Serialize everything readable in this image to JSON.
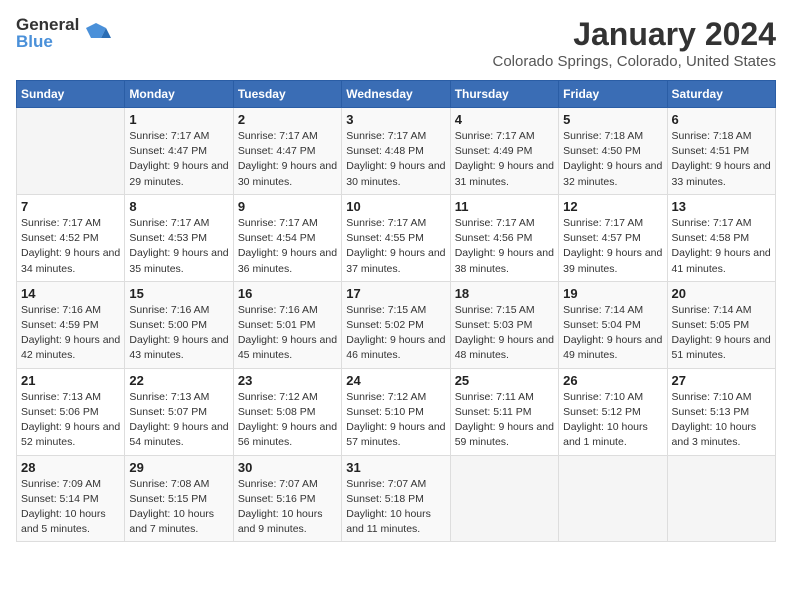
{
  "logo": {
    "general": "General",
    "blue": "Blue"
  },
  "title": "January 2024",
  "location": "Colorado Springs, Colorado, United States",
  "days_of_week": [
    "Sunday",
    "Monday",
    "Tuesday",
    "Wednesday",
    "Thursday",
    "Friday",
    "Saturday"
  ],
  "weeks": [
    [
      {
        "day": "",
        "sunrise": "",
        "sunset": "",
        "daylight": "",
        "empty": true
      },
      {
        "day": "1",
        "sunrise": "Sunrise: 7:17 AM",
        "sunset": "Sunset: 4:47 PM",
        "daylight": "Daylight: 9 hours and 29 minutes."
      },
      {
        "day": "2",
        "sunrise": "Sunrise: 7:17 AM",
        "sunset": "Sunset: 4:47 PM",
        "daylight": "Daylight: 9 hours and 30 minutes."
      },
      {
        "day": "3",
        "sunrise": "Sunrise: 7:17 AM",
        "sunset": "Sunset: 4:48 PM",
        "daylight": "Daylight: 9 hours and 30 minutes."
      },
      {
        "day": "4",
        "sunrise": "Sunrise: 7:17 AM",
        "sunset": "Sunset: 4:49 PM",
        "daylight": "Daylight: 9 hours and 31 minutes."
      },
      {
        "day": "5",
        "sunrise": "Sunrise: 7:18 AM",
        "sunset": "Sunset: 4:50 PM",
        "daylight": "Daylight: 9 hours and 32 minutes."
      },
      {
        "day": "6",
        "sunrise": "Sunrise: 7:18 AM",
        "sunset": "Sunset: 4:51 PM",
        "daylight": "Daylight: 9 hours and 33 minutes."
      }
    ],
    [
      {
        "day": "7",
        "sunrise": "Sunrise: 7:17 AM",
        "sunset": "Sunset: 4:52 PM",
        "daylight": "Daylight: 9 hours and 34 minutes."
      },
      {
        "day": "8",
        "sunrise": "Sunrise: 7:17 AM",
        "sunset": "Sunset: 4:53 PM",
        "daylight": "Daylight: 9 hours and 35 minutes."
      },
      {
        "day": "9",
        "sunrise": "Sunrise: 7:17 AM",
        "sunset": "Sunset: 4:54 PM",
        "daylight": "Daylight: 9 hours and 36 minutes."
      },
      {
        "day": "10",
        "sunrise": "Sunrise: 7:17 AM",
        "sunset": "Sunset: 4:55 PM",
        "daylight": "Daylight: 9 hours and 37 minutes."
      },
      {
        "day": "11",
        "sunrise": "Sunrise: 7:17 AM",
        "sunset": "Sunset: 4:56 PM",
        "daylight": "Daylight: 9 hours and 38 minutes."
      },
      {
        "day": "12",
        "sunrise": "Sunrise: 7:17 AM",
        "sunset": "Sunset: 4:57 PM",
        "daylight": "Daylight: 9 hours and 39 minutes."
      },
      {
        "day": "13",
        "sunrise": "Sunrise: 7:17 AM",
        "sunset": "Sunset: 4:58 PM",
        "daylight": "Daylight: 9 hours and 41 minutes."
      }
    ],
    [
      {
        "day": "14",
        "sunrise": "Sunrise: 7:16 AM",
        "sunset": "Sunset: 4:59 PM",
        "daylight": "Daylight: 9 hours and 42 minutes."
      },
      {
        "day": "15",
        "sunrise": "Sunrise: 7:16 AM",
        "sunset": "Sunset: 5:00 PM",
        "daylight": "Daylight: 9 hours and 43 minutes."
      },
      {
        "day": "16",
        "sunrise": "Sunrise: 7:16 AM",
        "sunset": "Sunset: 5:01 PM",
        "daylight": "Daylight: 9 hours and 45 minutes."
      },
      {
        "day": "17",
        "sunrise": "Sunrise: 7:15 AM",
        "sunset": "Sunset: 5:02 PM",
        "daylight": "Daylight: 9 hours and 46 minutes."
      },
      {
        "day": "18",
        "sunrise": "Sunrise: 7:15 AM",
        "sunset": "Sunset: 5:03 PM",
        "daylight": "Daylight: 9 hours and 48 minutes."
      },
      {
        "day": "19",
        "sunrise": "Sunrise: 7:14 AM",
        "sunset": "Sunset: 5:04 PM",
        "daylight": "Daylight: 9 hours and 49 minutes."
      },
      {
        "day": "20",
        "sunrise": "Sunrise: 7:14 AM",
        "sunset": "Sunset: 5:05 PM",
        "daylight": "Daylight: 9 hours and 51 minutes."
      }
    ],
    [
      {
        "day": "21",
        "sunrise": "Sunrise: 7:13 AM",
        "sunset": "Sunset: 5:06 PM",
        "daylight": "Daylight: 9 hours and 52 minutes."
      },
      {
        "day": "22",
        "sunrise": "Sunrise: 7:13 AM",
        "sunset": "Sunset: 5:07 PM",
        "daylight": "Daylight: 9 hours and 54 minutes."
      },
      {
        "day": "23",
        "sunrise": "Sunrise: 7:12 AM",
        "sunset": "Sunset: 5:08 PM",
        "daylight": "Daylight: 9 hours and 56 minutes."
      },
      {
        "day": "24",
        "sunrise": "Sunrise: 7:12 AM",
        "sunset": "Sunset: 5:10 PM",
        "daylight": "Daylight: 9 hours and 57 minutes."
      },
      {
        "day": "25",
        "sunrise": "Sunrise: 7:11 AM",
        "sunset": "Sunset: 5:11 PM",
        "daylight": "Daylight: 9 hours and 59 minutes."
      },
      {
        "day": "26",
        "sunrise": "Sunrise: 7:10 AM",
        "sunset": "Sunset: 5:12 PM",
        "daylight": "Daylight: 10 hours and 1 minute."
      },
      {
        "day": "27",
        "sunrise": "Sunrise: 7:10 AM",
        "sunset": "Sunset: 5:13 PM",
        "daylight": "Daylight: 10 hours and 3 minutes."
      }
    ],
    [
      {
        "day": "28",
        "sunrise": "Sunrise: 7:09 AM",
        "sunset": "Sunset: 5:14 PM",
        "daylight": "Daylight: 10 hours and 5 minutes."
      },
      {
        "day": "29",
        "sunrise": "Sunrise: 7:08 AM",
        "sunset": "Sunset: 5:15 PM",
        "daylight": "Daylight: 10 hours and 7 minutes."
      },
      {
        "day": "30",
        "sunrise": "Sunrise: 7:07 AM",
        "sunset": "Sunset: 5:16 PM",
        "daylight": "Daylight: 10 hours and 9 minutes."
      },
      {
        "day": "31",
        "sunrise": "Sunrise: 7:07 AM",
        "sunset": "Sunset: 5:18 PM",
        "daylight": "Daylight: 10 hours and 11 minutes."
      },
      {
        "day": "",
        "sunrise": "",
        "sunset": "",
        "daylight": "",
        "empty": true
      },
      {
        "day": "",
        "sunrise": "",
        "sunset": "",
        "daylight": "",
        "empty": true
      },
      {
        "day": "",
        "sunrise": "",
        "sunset": "",
        "daylight": "",
        "empty": true
      }
    ]
  ]
}
